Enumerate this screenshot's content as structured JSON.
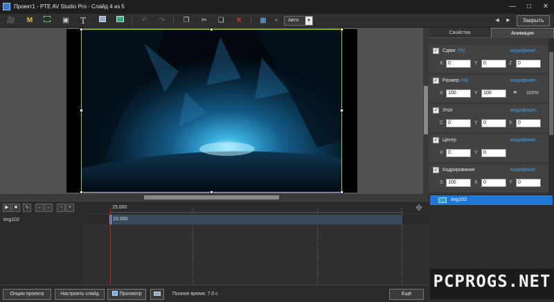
{
  "window": {
    "title": "Проект1 - PTE AV Studio Pro - Слайд 4 из 5",
    "minimize_icon": "minimize-icon",
    "maximize_icon": "maximize-icon",
    "close_icon": "close-icon"
  },
  "toolbar": {
    "zoom_value": "Авто",
    "close_label": "Закрыть"
  },
  "tabs": {
    "properties": "Свойства",
    "animation": "Анимация"
  },
  "animation": {
    "link_label": "модификат...",
    "pan": {
      "label": "Сдвиг",
      "unit": "(%)",
      "x": "0",
      "y": "0",
      "z": "0"
    },
    "size": {
      "label": "Размер",
      "unit": "(%)",
      "x": "100",
      "y": "100",
      "lock_percent": "100%"
    },
    "angle": {
      "label": "Угол",
      "c": "0",
      "y": "0",
      "x": "0"
    },
    "center": {
      "label": "Центр",
      "x": "0",
      "y": "0"
    },
    "crop": {
      "label": "Кадрирование",
      "s": "100",
      "x": "0",
      "y": "0"
    },
    "axis": {
      "x": "X",
      "y": "Y",
      "z": "Z",
      "c": "C",
      "s": "S"
    }
  },
  "layers": [
    {
      "name": "img102",
      "selected": true
    }
  ],
  "timeline": {
    "ruler_time": "15.000",
    "track_name": "img102",
    "clip_time": "15.000"
  },
  "bottom": {
    "project_options": "Опции проекта",
    "slide_options": "Настроить слайд",
    "preview": "Просмотр",
    "total_time": "Полное время: 7.0 с",
    "more": "Ещё"
  },
  "watermark": "PCPROGS.NET",
  "colors": {
    "accent": "#1f78d8",
    "link": "#4aa0e6",
    "selection_frame": "#b6c93a",
    "playhead": "#c02020"
  }
}
